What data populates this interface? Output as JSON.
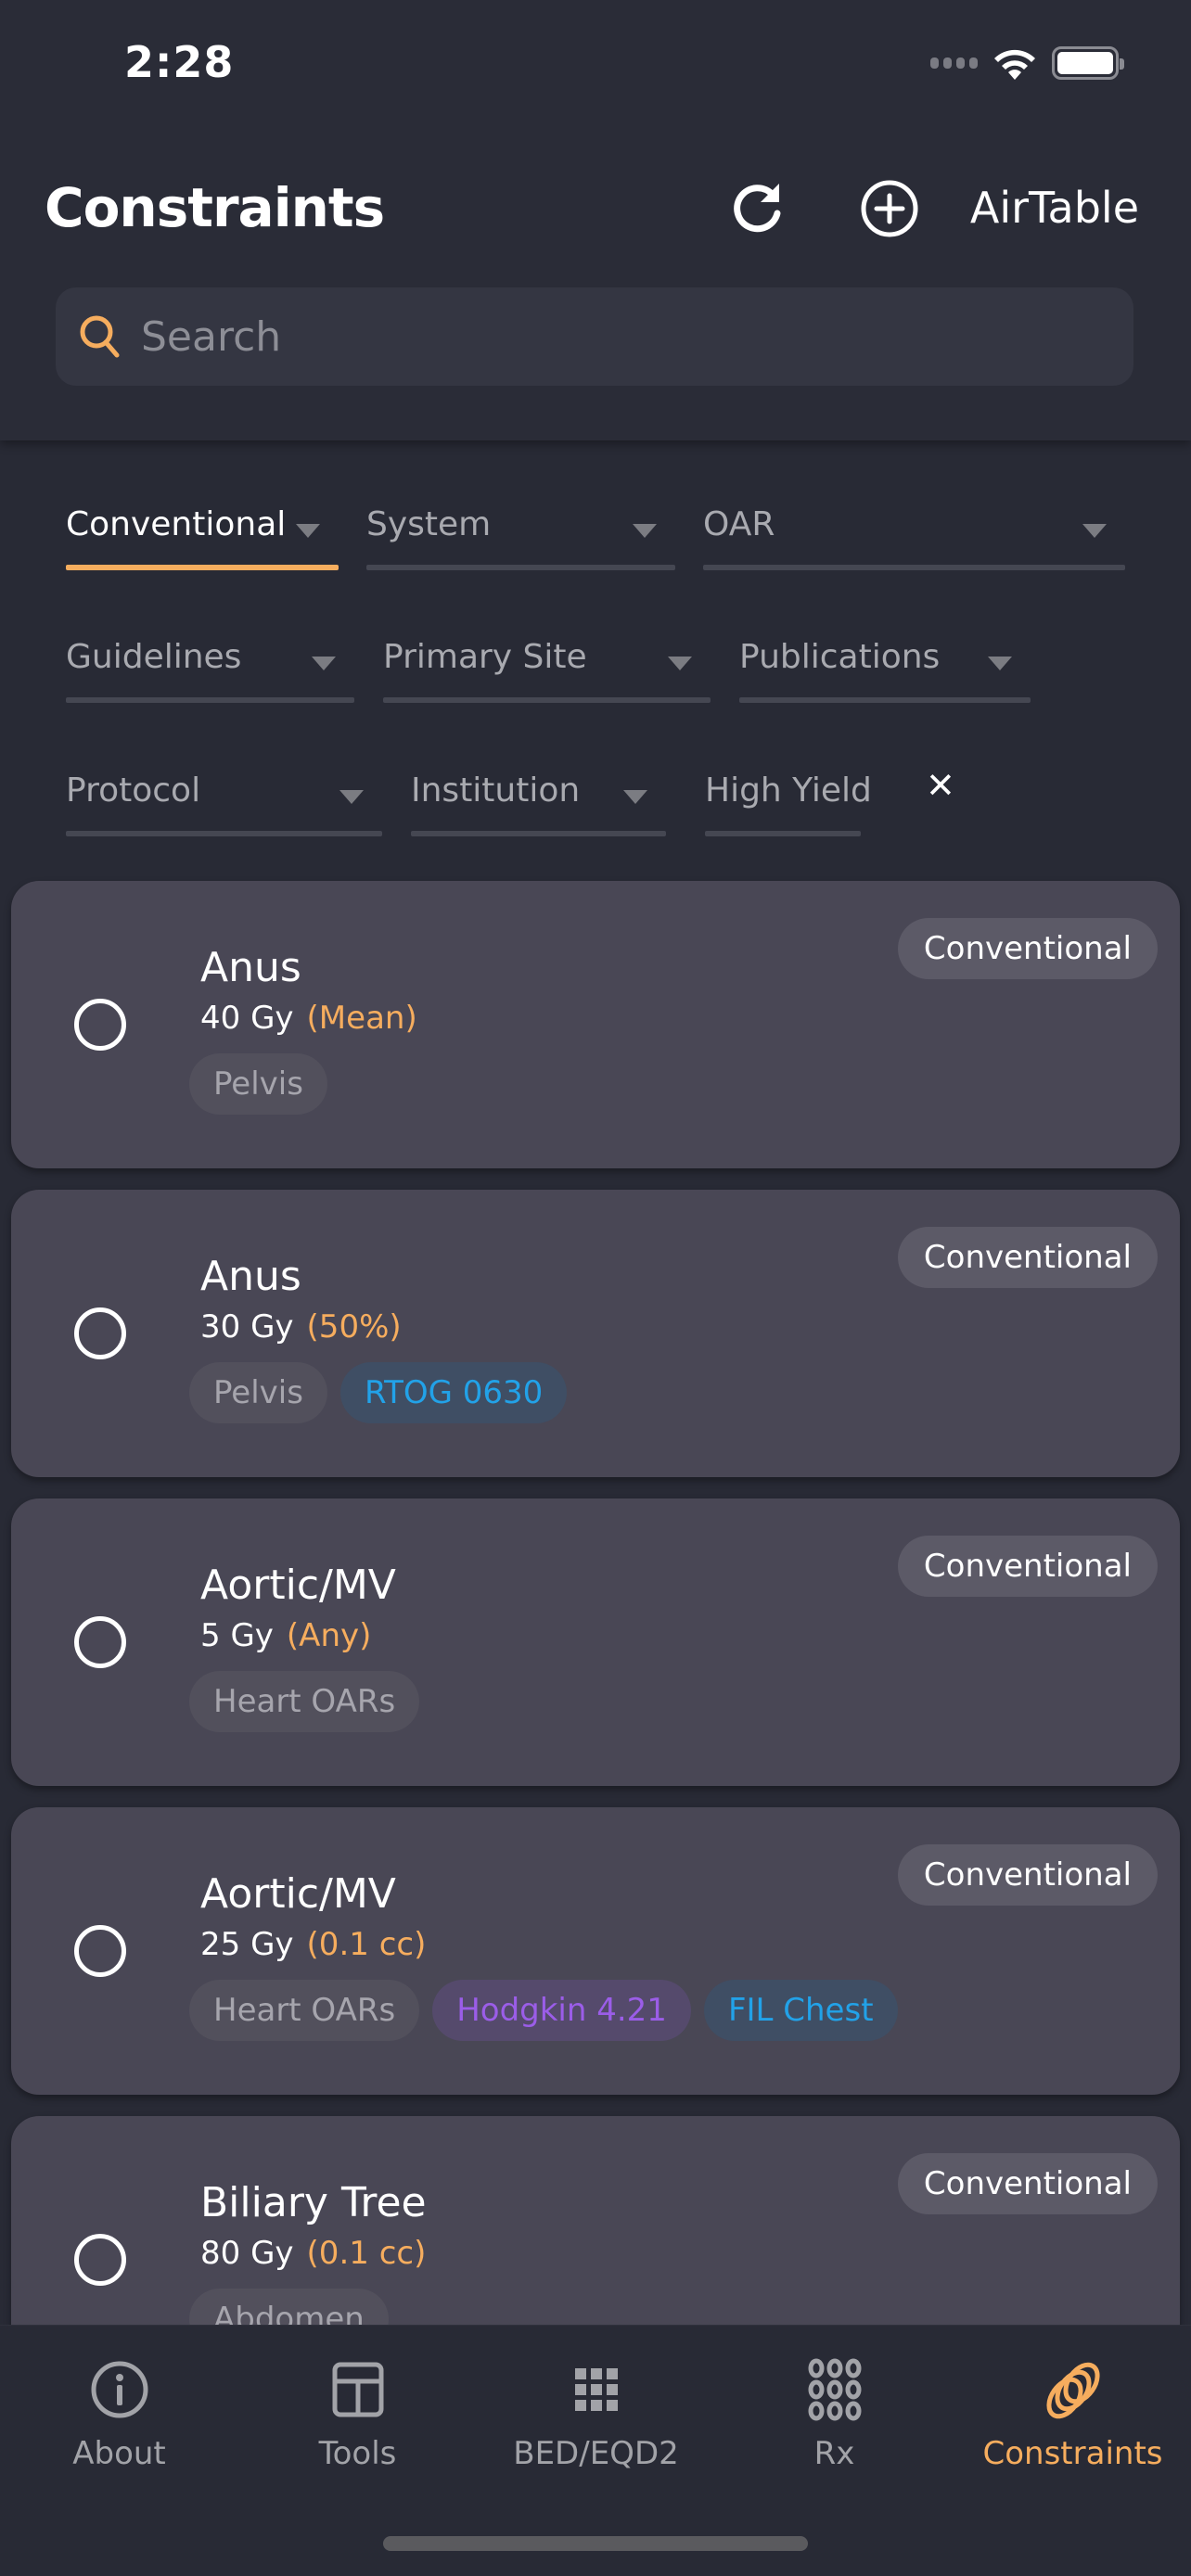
{
  "status_bar": {
    "time": "2:28"
  },
  "header": {
    "title": "Constraints",
    "refresh_icon": "refresh-icon",
    "add_icon": "plus-circle-icon",
    "airtable_label": "AirTable"
  },
  "search": {
    "placeholder": "Search",
    "value": "",
    "icon": "search-icon"
  },
  "filters": [
    {
      "label": "Conventional",
      "active": true,
      "has_dropdown": true
    },
    {
      "label": "System",
      "active": false,
      "has_dropdown": true
    },
    {
      "label": "OAR",
      "active": false,
      "has_dropdown": true
    },
    {
      "label": "Guidelines",
      "active": false,
      "has_dropdown": true
    },
    {
      "label": "Primary Site",
      "active": false,
      "has_dropdown": true
    },
    {
      "label": "Publications",
      "active": false,
      "has_dropdown": true
    },
    {
      "label": "Protocol",
      "active": false,
      "has_dropdown": true
    },
    {
      "label": "Institution",
      "active": false,
      "has_dropdown": true
    },
    {
      "label": "High Yield",
      "active": false,
      "has_dropdown": false
    }
  ],
  "clear_filters_label": "✕",
  "constraints": [
    {
      "organ": "Anus",
      "dose": "40 Gy",
      "qualifier": "(Mean)",
      "badge": "Conventional",
      "tags": [
        {
          "label": "Pelvis",
          "color": "gray"
        }
      ]
    },
    {
      "organ": "Anus",
      "dose": "30 Gy",
      "qualifier": "(50%)",
      "badge": "Conventional",
      "tags": [
        {
          "label": "Pelvis",
          "color": "gray"
        },
        {
          "label": "RTOG 0630",
          "color": "blue"
        }
      ]
    },
    {
      "organ": "Aortic/MV",
      "dose": "5 Gy",
      "qualifier": "(Any)",
      "badge": "Conventional",
      "tags": [
        {
          "label": "Heart OARs",
          "color": "gray"
        }
      ]
    },
    {
      "organ": "Aortic/MV",
      "dose": "25 Gy",
      "qualifier": "(0.1 cc)",
      "badge": "Conventional",
      "tags": [
        {
          "label": "Heart OARs",
          "color": "gray"
        },
        {
          "label": "Hodgkin 4.21",
          "color": "purple"
        },
        {
          "label": "FIL Chest",
          "color": "blue"
        }
      ]
    },
    {
      "organ": "Biliary Tree",
      "dose": "80 Gy",
      "qualifier": "(0.1 cc)",
      "badge": "Conventional",
      "tags": [
        {
          "label": "Abdomen",
          "color": "gray"
        }
      ]
    }
  ],
  "tabbar": {
    "items": [
      {
        "label": "About",
        "icon": "info-icon",
        "active": false
      },
      {
        "label": "Tools",
        "icon": "layout-icon",
        "active": false
      },
      {
        "label": "BED/EQD2",
        "icon": "grid-icon",
        "active": false
      },
      {
        "label": "Rx",
        "icon": "dots-grid-icon",
        "active": false
      },
      {
        "label": "Constraints",
        "icon": "rings-icon",
        "active": true
      }
    ]
  },
  "colors": {
    "accent": "#f6ad5e",
    "background": "#282a35",
    "card": "#494755",
    "tag_blue": "#22a2e8",
    "tag_purple": "#9b5de8"
  }
}
